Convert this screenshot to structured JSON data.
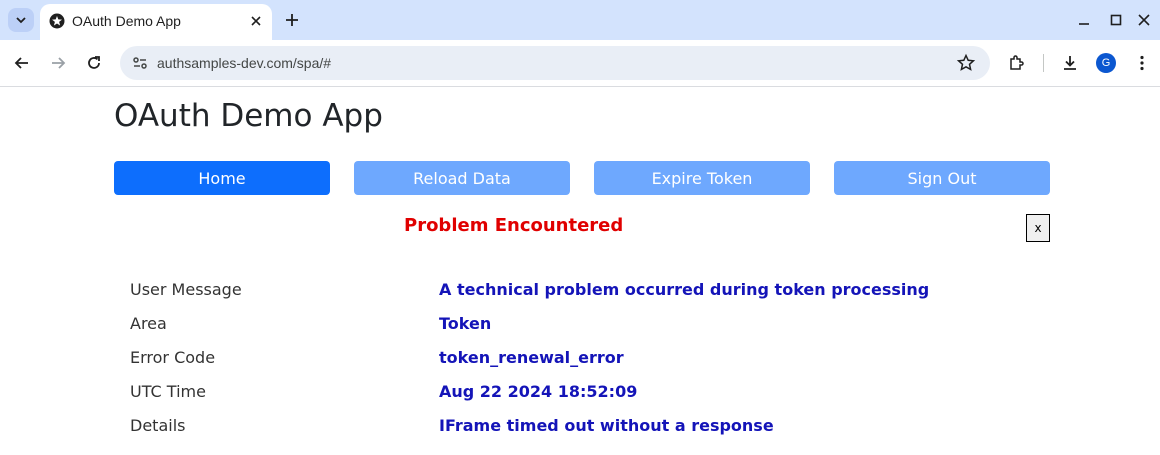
{
  "browser": {
    "tab_title": "OAuth Demo App",
    "url": "authsamples-dev.com/spa/#",
    "profile_initial": "G"
  },
  "app": {
    "title": "OAuth Demo App",
    "nav": [
      {
        "label": "Home",
        "style": "primary"
      },
      {
        "label": "Reload Data",
        "style": "faded"
      },
      {
        "label": "Expire Token",
        "style": "faded"
      },
      {
        "label": "Sign Out",
        "style": "faded"
      }
    ]
  },
  "error": {
    "title": "Problem Encountered",
    "close_label": "x",
    "rows": [
      {
        "label": "User Message",
        "value": "A technical problem occurred during token processing"
      },
      {
        "label": "Area",
        "value": "Token"
      },
      {
        "label": "Error Code",
        "value": "token_renewal_error"
      },
      {
        "label": "UTC Time",
        "value": "Aug 22 2024 18:52:09"
      },
      {
        "label": "Details",
        "value": "IFrame timed out without a response"
      }
    ]
  },
  "colors": {
    "primary": "#0d6efd",
    "faded": "#6ea8fe",
    "error_title": "#e00000",
    "error_value": "#1414b8"
  }
}
